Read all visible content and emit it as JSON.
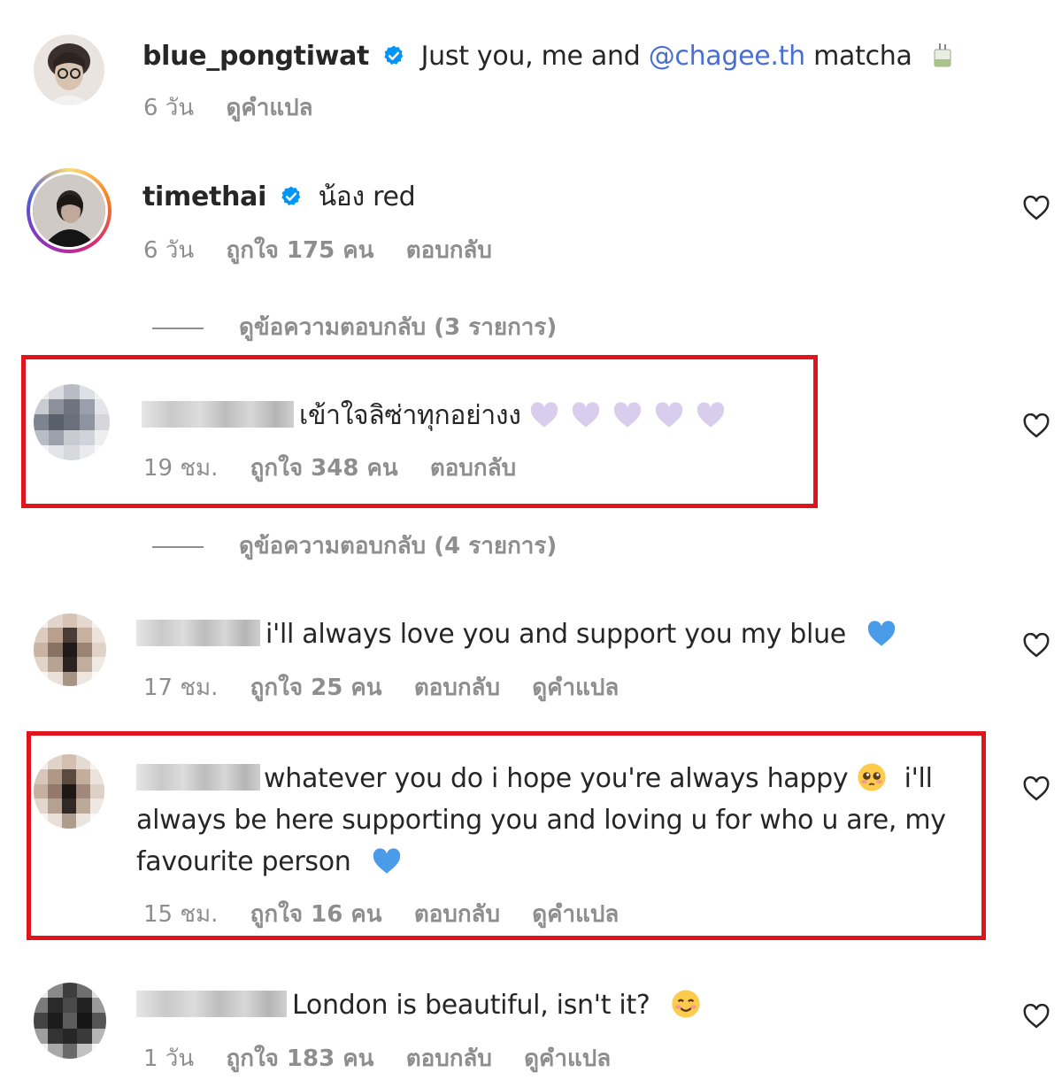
{
  "comments": [
    {
      "username": "blue_pongtiwat",
      "text_before_mention": "Just you, me and ",
      "mention": "@chagee.th",
      "text_after_mention": " matcha",
      "time": "6 วัน",
      "translate": "ดูคำแปล"
    },
    {
      "username": "timethai",
      "text": "น้อง red",
      "time": "6 วัน",
      "likes": "ถูกใจ 175 คน",
      "reply": "ตอบกลับ",
      "view_replies": "ดูข้อความตอบกลับ (3 รายการ)"
    },
    {
      "text": "เข้าใจลิซ่าทุกอย่างง",
      "time": "19 ชม.",
      "likes": "ถูกใจ 348 คน",
      "reply": "ตอบกลับ",
      "view_replies": "ดูข้อความตอบกลับ (4 รายการ)"
    },
    {
      "text": "i'll always love you and support you my blue",
      "time": "17 ชม.",
      "likes": "ถูกใจ 25 คน",
      "reply": "ตอบกลับ",
      "translate": "ดูคำแปล"
    },
    {
      "text_part1": "whatever you do i hope you're always happy",
      "text_part2": " i'll always be here supporting you and loving u for who u are, my favourite person",
      "time": "15 ชม.",
      "likes": "ถูกใจ 16 คน",
      "reply": "ตอบกลับ",
      "translate": "ดูคำแปล"
    },
    {
      "text": "London is beautiful, isn't it?",
      "time": "1 วัน",
      "likes": "ถูกใจ 183 คน",
      "reply": "ตอบกลับ",
      "translate": "ดูคำแปล"
    }
  ],
  "colors": {
    "highlight": "#e0141c",
    "mention": "#4a6fd1",
    "verified": "#0095f6",
    "meta_text": "#8e8e8e"
  },
  "icons": [
    "verified-badge-icon",
    "heart-outline-icon",
    "purple-heart-emoji",
    "blue-heart-emoji",
    "pleading-face-emoji",
    "smiling-face-emoji",
    "drink-emoji"
  ]
}
